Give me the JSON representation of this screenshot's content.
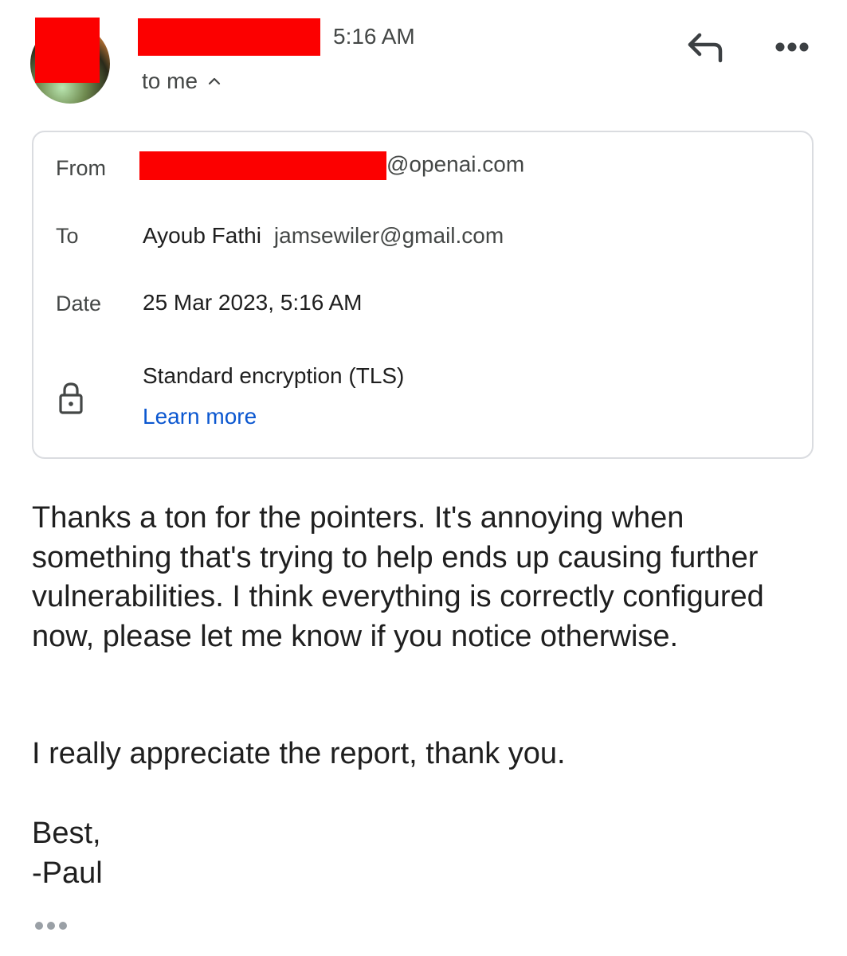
{
  "header": {
    "sender_name_redacted": true,
    "time": "5:16 AM",
    "recipient_summary": "to me",
    "icons": {
      "reply": "reply-icon",
      "more": "more-horizontal-icon",
      "expand": "chevron-up-icon"
    }
  },
  "details": {
    "from_label": "From",
    "from_domain": "@openai.com",
    "to_label": "To",
    "to_name": "Ayoub Fathi",
    "to_email": "jamsewiler@gmail.com",
    "date_label": "Date",
    "date_value": "25 Mar 2023, 5:16 AM",
    "encryption_icon": "lock-icon",
    "encryption_text": "Standard encryption (TLS)",
    "learn_more": "Learn more"
  },
  "message": {
    "paragraph1": "Thanks a ton for the pointers. It's annoying when something that's trying to help ends up causing further vulnerabilities. I think everything is correctly configured now, please let me know if you notice otherwise.",
    "paragraph2": "I really appreciate the report, thank you.",
    "signoff": "Best,",
    "signature": "-Paul",
    "trimmed_content_icon": "ellipsis-icon"
  },
  "colors": {
    "redaction": "#fc0000",
    "link": "#0b57d0",
    "muted_text": "#444746",
    "border": "#dadce0"
  }
}
